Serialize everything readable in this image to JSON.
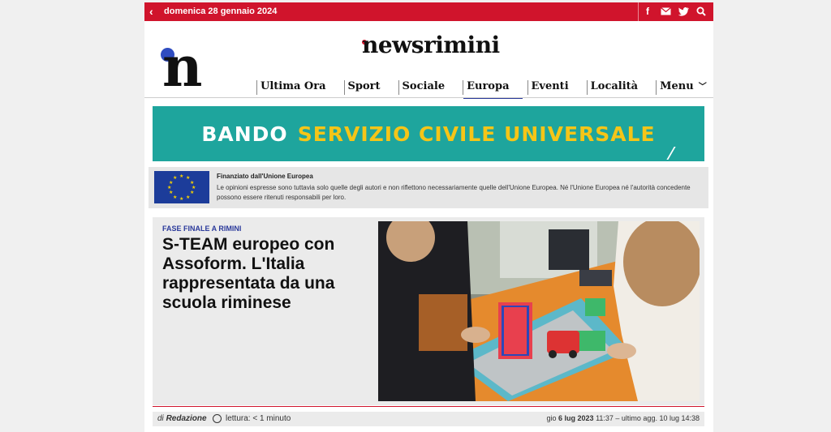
{
  "topbar": {
    "date": "domenica 28 gennaio 2024",
    "back_icon": "chevron-left-icon",
    "socials": [
      "facebook-icon",
      "mail-icon",
      "twitter-icon",
      "search-icon"
    ]
  },
  "header": {
    "logo_text": "newsrimini",
    "logo_mark": "n"
  },
  "nav": {
    "items": [
      "Ultima Ora",
      "Sport",
      "Sociale",
      "Europa",
      "Eventi",
      "Località",
      "Menu"
    ],
    "active": "Europa"
  },
  "banner": {
    "word1": "BANDO",
    "word2": "SERVIZIO CIVILE UNIVERSALE"
  },
  "eu": {
    "title": "Finanziato dall'Unione Europea",
    "text": "Le opinioni espresse sono tuttavia solo quelle degli autori e non riflettono necessariamente quelle dell'Unione Europea. Né l'Unione Europea né l'autorità concedente possono essere ritenuti responsabili per loro."
  },
  "article": {
    "kicker": "FASE FINALE A RIMINI",
    "headline": "S-TEAM europeo con Assoform. L'Italia rappresentata da una scuola riminese",
    "author_prefix": "di",
    "author": "Redazione",
    "reading": "lettura: < 1 minuto",
    "published_day": "gio",
    "published_date": "6 lug 2023",
    "published_rest": "11:37 – ultimo agg. 10 lug 14:38"
  },
  "colors": {
    "brand_red": "#d0142c",
    "banner_teal": "#1ea59d",
    "banner_yellow": "#f5c518",
    "eu_blue": "#1c3c9a",
    "accent_blue": "#2b3a9b"
  }
}
